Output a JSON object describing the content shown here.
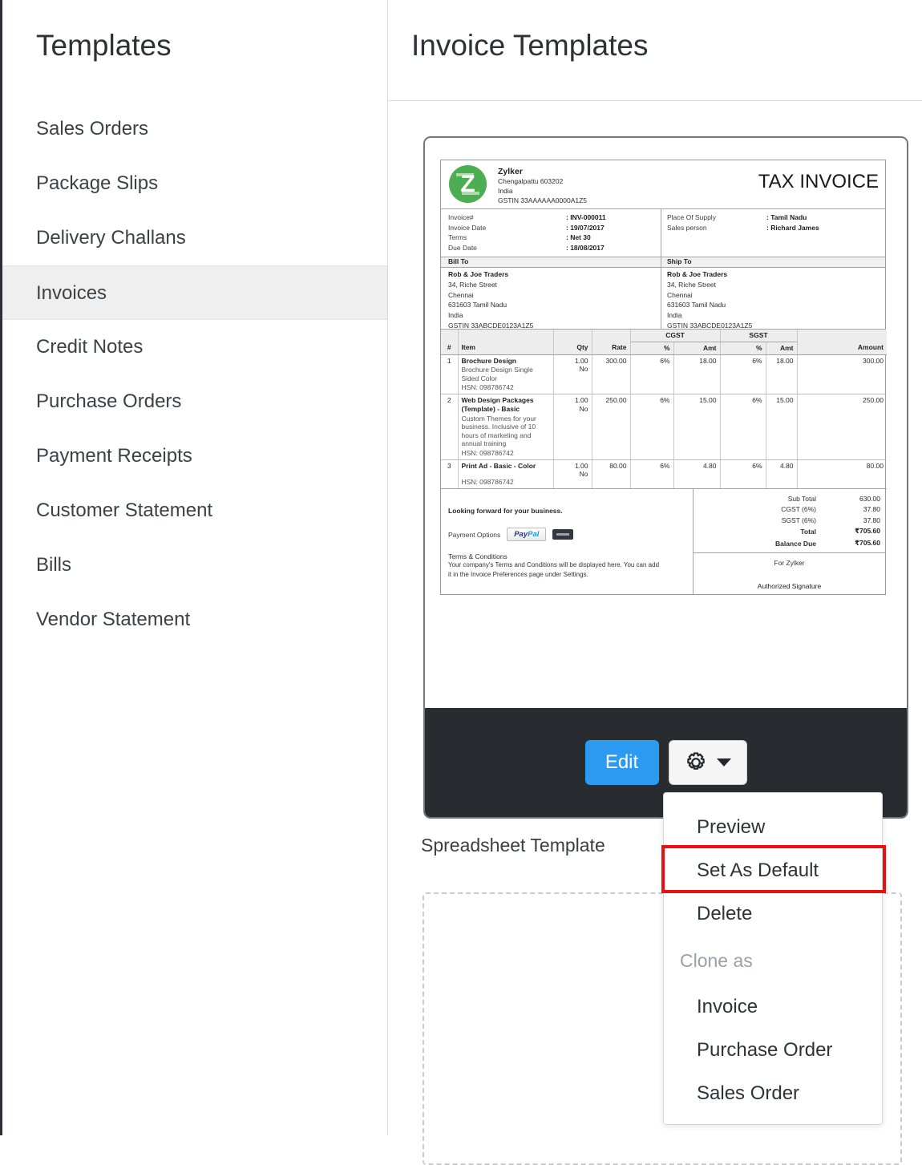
{
  "colors": {
    "accent_blue": "#2b9af0",
    "highlight_red": "#e8110d",
    "logo_green": "#4cae50",
    "footer_dark": "#282c31",
    "active_item_bg": "#efefef"
  },
  "sidebar": {
    "title": "Templates",
    "items": [
      {
        "label": "Sales Orders"
      },
      {
        "label": "Package Slips"
      },
      {
        "label": "Delivery Challans"
      },
      {
        "label": "Invoices"
      },
      {
        "label": "Credit Notes"
      },
      {
        "label": "Purchase Orders"
      },
      {
        "label": "Payment Receipts"
      },
      {
        "label": "Customer Statement"
      },
      {
        "label": "Bills"
      },
      {
        "label": "Vendor Statement"
      }
    ],
    "active_item": "Invoices"
  },
  "main": {
    "title": "Invoice Templates",
    "spreadsheet_section_label": "Spreadsheet Template"
  },
  "card": {
    "edit_label": "Edit"
  },
  "menu": {
    "preview": "Preview",
    "set_as_default": "Set As Default",
    "delete": "Delete",
    "group_label": "Clone as",
    "clone_invoice": "Invoice",
    "clone_purchase_order": "Purchase Order",
    "clone_sales_order": "Sales Order",
    "highlighted_item": "Set As Default"
  },
  "invoice": {
    "doc_title": "TAX INVOICE",
    "company": {
      "logo_letter": "Z",
      "name": "Zylker",
      "address1": "Chengalpattu  603202",
      "address2": "India",
      "gstin": "GSTIN 33AAAAAA0000A1Z5"
    },
    "meta_left": {
      "l1": "Invoice#",
      "v1": ": INV-000011",
      "l2": "Invoice Date",
      "v2": ": 19/07/2017",
      "l3": "Terms",
      "v3": ": Net 30",
      "l4": "Due Date",
      "v4": ": 18/08/2017"
    },
    "meta_right": {
      "l1": "Place Of Supply",
      "v1": ": Tamil Nadu",
      "l2": "Sales person",
      "v2": ": Richard James"
    },
    "bill_to": {
      "heading": "Bill To",
      "name": "Rob & Joe Traders",
      "line1": "34, Riche Street",
      "line2": "Chennai",
      "line3": "631603 Tamil Nadu",
      "line4": "India",
      "line5": "GSTIN 33ABCDE0123A1Z5"
    },
    "ship_to": {
      "heading": "Ship To",
      "name": "Rob & Joe Traders",
      "line1": "34, Riche Street",
      "line2": "Chennai",
      "line3": "631603 Tamil Nadu",
      "line4": "India",
      "line5": "GSTIN 33ABCDE0123A1Z5"
    },
    "table": {
      "group_cgst": "CGST",
      "group_sgst": "SGST",
      "h_num": "#",
      "h_item": "Item",
      "h_qty": "Qty",
      "h_rate": "Rate",
      "h_pct": "%",
      "h_amt": "Amt",
      "h_pct2": "%",
      "h_amt2": "Amt",
      "h_amount": "Amount",
      "rows": [
        {
          "num": "1",
          "name": "Brochure Design",
          "desc": "Brochure Design Single Sided Color",
          "hsn": "HSN: 098786742",
          "qty": "1.00",
          "qty2": "No",
          "rate": "300.00",
          "cgst_pct": "6%",
          "cgst_amt": "18.00",
          "sgst_pct": "6%",
          "sgst_amt": "18.00",
          "amount": "300.00"
        },
        {
          "num": "2",
          "name": "Web Design Packages (Template) - Basic",
          "desc": "Custom Themes for your business. Inclusive of 10 hours of marketing and annual training",
          "hsn": "HSN: 098786742",
          "qty": "1.00",
          "qty2": "No",
          "rate": "250.00",
          "cgst_pct": "6%",
          "cgst_amt": "15.00",
          "sgst_pct": "6%",
          "sgst_amt": "15.00",
          "amount": "250.00"
        },
        {
          "num": "3",
          "name": "Print Ad - Basic - Color",
          "desc": "",
          "hsn": "HSN: 098786742",
          "qty": "1.00",
          "qty2": "No",
          "rate": "80.00",
          "cgst_pct": "6%",
          "cgst_amt": "4.80",
          "sgst_pct": "6%",
          "sgst_amt": "4.80",
          "amount": "80.00"
        }
      ]
    },
    "totals": {
      "sub_total_label": "Sub Total",
      "sub_total": "630.00",
      "cgst_label": "CGST (6%)",
      "cgst": "37.80",
      "sgst_label": "SGST (6%)",
      "sgst": "37.80",
      "total_label": "Total",
      "total": "₹705.60",
      "balance_label": "Balance Due",
      "balance": "₹705.60"
    },
    "signature": {
      "for_label": "For Zylker",
      "line_label": "Authorized Signature"
    },
    "notes": {
      "thanks": "Looking forward for your business.",
      "payment_label": "Payment Options",
      "paypal_1": "Pay",
      "paypal_2": "Pal",
      "terms_title": "Terms & Conditions",
      "terms_line1": "Your company's Terms and Conditions will be displayed here. You can add",
      "terms_line2": "it in the Invoice Preferences page under Settings."
    }
  }
}
